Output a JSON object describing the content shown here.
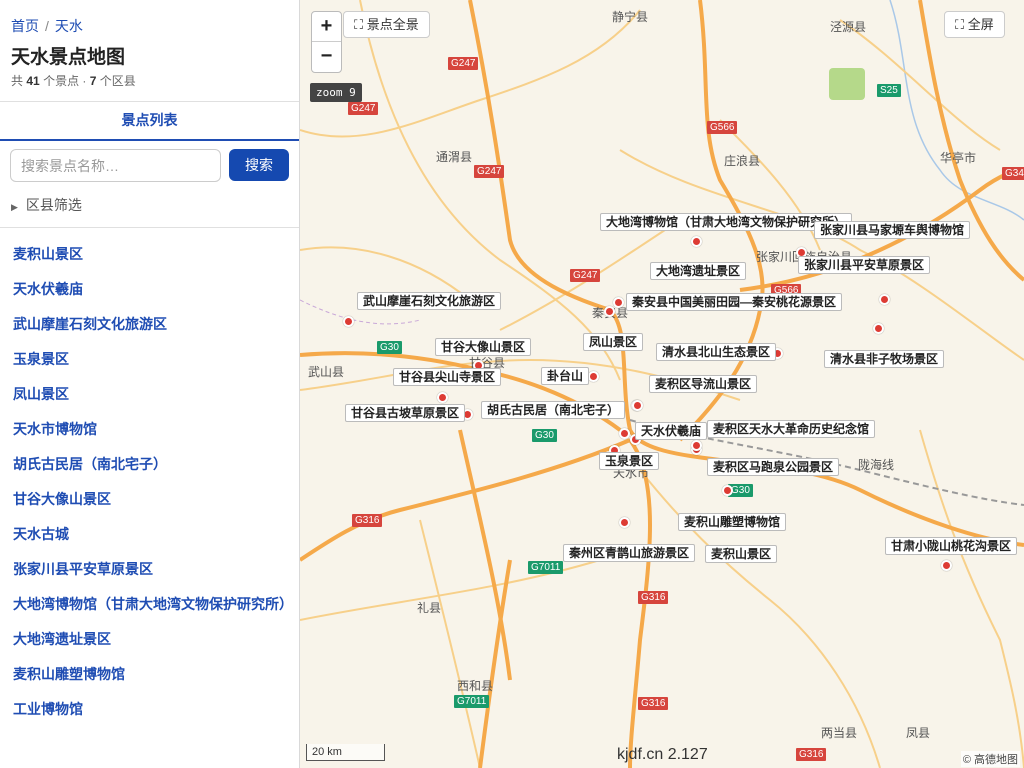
{
  "breadcrumb": {
    "home": "首页",
    "separator": "/",
    "current": "天水"
  },
  "page": {
    "title": "天水景点地图",
    "stats_prefix": "共",
    "spot_count": "41",
    "stats_mid": "个景点 ·",
    "district_count": "7",
    "stats_suffix": "个区县"
  },
  "tab": {
    "label": "景点列表"
  },
  "search": {
    "placeholder": "搜索景点名称…",
    "button": "搜索"
  },
  "filter": {
    "label": "区县筛选"
  },
  "spots": [
    "麦积山景区",
    "天水伏羲庙",
    "武山摩崖石刻文化旅游区",
    "玉泉景区",
    "凤山景区",
    "天水市博物馆",
    "胡氏古民居（南北宅子）",
    "甘谷大像山景区",
    "天水古城",
    "张家川县平安草原景区",
    "大地湾博物馆（甘肃大地湾文物保护研究所）",
    "大地湾遗址景区",
    "麦积山雕塑博物馆",
    "工业博物馆"
  ],
  "map": {
    "zoom_in": "+",
    "zoom_out": "−",
    "overview_button": "景点全景",
    "fullscreen_button": "全屏",
    "zoom_level": "zoom 9",
    "scale": "20 km",
    "watermark": "kjdf.cn 2.127",
    "attribution": "© 高德地图",
    "poi_labels": [
      "大地湾博物馆（甘肃大地湾文物保护研究所）",
      "张家川县马家塬车舆博物馆",
      "张家川县平安草原景区",
      "大地湾遗址景区",
      "武山摩崖石刻文化旅游区",
      "秦安县中国美丽田园—秦安桃花源景区",
      "凤山景区",
      "清水县北山生态景区",
      "清水县非子牧场景区",
      "甘谷大像山景区",
      "甘谷县尖山寺景区",
      "卦台山",
      "麦积区导流山景区",
      "甘谷县古坡草原景区",
      "胡氏古民居（南北宅子）",
      "天水伏羲庙",
      "麦积区天水大革命历史纪念馆",
      "玉泉景区",
      "麦积区马跑泉公园景区",
      "麦积山雕塑博物馆",
      "秦州区青鹊山旅游景区",
      "麦积山景区",
      "甘肃小陇山桃花沟景区"
    ],
    "places": [
      "静宁县",
      "泾源县",
      "通渭县",
      "庄浪县",
      "华亭市",
      "张家川回族自治县",
      "秦安县",
      "甘谷县",
      "武山县",
      "天水市",
      "陇海线",
      "礼县",
      "西和县",
      "两当县",
      "凤县"
    ],
    "roads": [
      "G247",
      "G247",
      "G247",
      "G247",
      "G566",
      "G566",
      "S25",
      "G30",
      "G30",
      "G30",
      "G316",
      "G316",
      "G316",
      "G316",
      "G7011",
      "G7011",
      "G34"
    ],
    "colors": {
      "road_major": "#f5a94a",
      "road_minor": "#f7d08a",
      "shield_red": "#d6453d",
      "shield_green": "#1a9a6b",
      "poi_marker": "#dd3b34",
      "background": "#f8f4ea",
      "accent": "#1549b0"
    }
  }
}
